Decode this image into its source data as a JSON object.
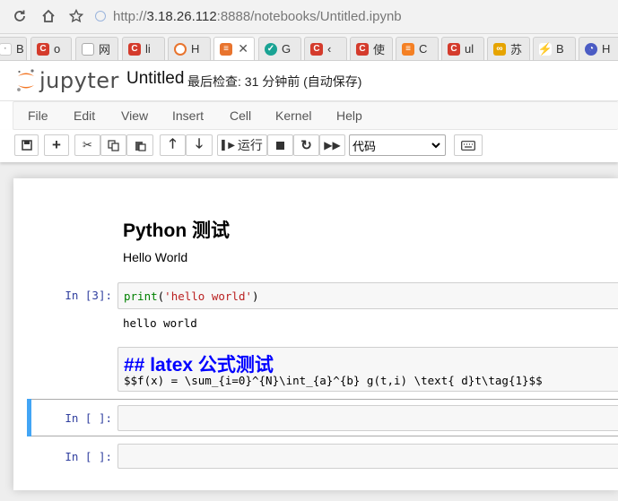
{
  "browser": {
    "url_prefix": "http://",
    "url_host": "3.18.26.112",
    "url_rest": ":8888/notebooks/Untitled.ipynb",
    "tabs": [
      {
        "label": "B",
        "icon": "page-icon",
        "color": "#cc3b2b"
      },
      {
        "label": "o",
        "icon": "csdn-icon",
        "color": "#d43b2c"
      },
      {
        "label": "网",
        "icon": "page-icon",
        "color": "#888888"
      },
      {
        "label": "li",
        "icon": "csdn-icon",
        "color": "#d43b2c"
      },
      {
        "label": "H",
        "icon": "jupyter-icon",
        "color": "#e8742e"
      },
      {
        "label": "",
        "icon": "book-icon",
        "color": "#e8742e"
      },
      {
        "label": "G",
        "icon": "bird-icon",
        "color": "#1aa394"
      },
      {
        "label": "‹",
        "icon": "csdn-icon",
        "color": "#d43b2c"
      },
      {
        "label": "使",
        "icon": "csdn-icon",
        "color": "#d43b2c"
      },
      {
        "label": "C",
        "icon": "stackoverflow-icon",
        "color": "#f48024"
      },
      {
        "label": "ul",
        "icon": "csdn-icon",
        "color": "#d43b2c"
      },
      {
        "label": "苏",
        "icon": "infinity-icon",
        "color": "#e6a400"
      },
      {
        "label": "B",
        "icon": "bolt-icon",
        "color": "#e23b3b"
      },
      {
        "label": "H",
        "icon": "gauge-icon",
        "color": "#4b5cc4"
      }
    ]
  },
  "header": {
    "logo_text": "jupyter",
    "notebook_name": "Untitled",
    "status": "最后检查: 31 分钟前  (自动保存)"
  },
  "menu": [
    "File",
    "Edit",
    "View",
    "Insert",
    "Cell",
    "Kernel",
    "Help"
  ],
  "toolbar": {
    "run_label": "运行",
    "cell_type": "代码"
  },
  "cells": {
    "md_title": "Python 测试",
    "md_text": "Hello World",
    "code1_prompt": "In [3]:",
    "code1_fn": "print",
    "code1_open": "(",
    "code1_str": "'hello world'",
    "code1_close": ")",
    "code1_output": "hello world",
    "md_raw_heading": "## latex 公式测试",
    "md_raw_latex": "$$f(x) = \\sum_{i=0}^{N}\\int_{a}^{b} g(t,i) \\text{ d}t\\tag{1}$$",
    "empty1_prompt": "In [ ]:",
    "empty2_prompt": "In [ ]:"
  }
}
